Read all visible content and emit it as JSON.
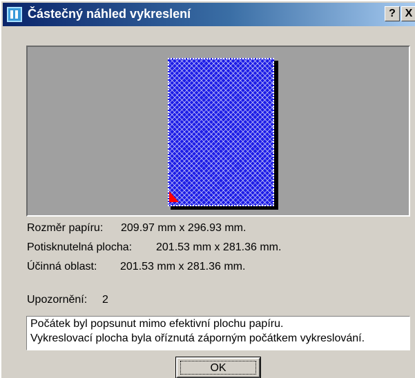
{
  "window": {
    "title": "Částečný náhled vykreslení",
    "help_label": "?",
    "close_label": "X"
  },
  "info": {
    "paper_size_label": "Rozměr papíru:",
    "paper_size_value": "209.97 mm x 296.93 mm.",
    "printable_area_label": "Potisknutelná plocha:",
    "printable_area_value": "201.53 mm x 281.36 mm.",
    "effective_area_label": "Účinná oblast:",
    "effective_area_value": "201.53 mm x 281.36 mm."
  },
  "warnings": {
    "label": "Upozornění:",
    "count": "2",
    "messages": [
      "Počátek byl popsunut mimo efektivní plochu papíru.",
      "Vykreslovací plocha byla oříznutá záporným počátkem vykreslování."
    ]
  },
  "buttons": {
    "ok_label": "OK"
  },
  "colors": {
    "paper_fill": "#1c1ce6",
    "origin_marker": "#ff0000",
    "titlebar_start": "#0a246a"
  }
}
